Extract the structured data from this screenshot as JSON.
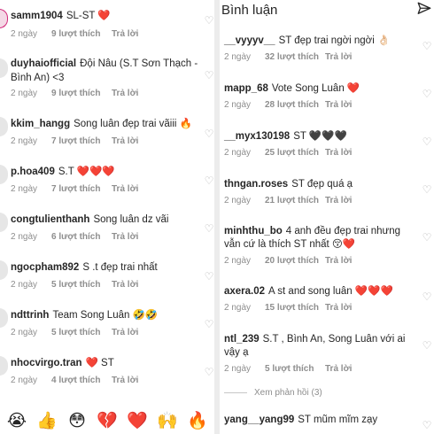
{
  "left_panel": {
    "comments": [
      {
        "user": "samm1904",
        "text": "SL-ST ❤️",
        "time": "2 ngày",
        "likes": "9 lượt thích",
        "reply": "Trả lời"
      },
      {
        "user": "duyhaiofficial",
        "text": "Đội Nâu (S.T Sơn Thạch -",
        "text2": "Bình An) <3",
        "time": "2 ngày",
        "likes": "9 lượt thích",
        "reply": "Trả lời"
      },
      {
        "user": "kkim_hangg",
        "text": "Song luân đẹp trai vãiii 🔥",
        "time": "2 ngày",
        "likes": "7 lượt thích",
        "reply": "Trả lời"
      },
      {
        "user": "p.hoa409",
        "text": "S.T ❤️❤️❤️",
        "time": "2 ngày",
        "likes": "7 lượt thích",
        "reply": "Trả lời"
      },
      {
        "user": "congtulienthanh",
        "text": "Song luân dz vãi",
        "time": "2 ngày",
        "likes": "6 lượt thích",
        "reply": "Trả lời"
      },
      {
        "user": "ngocpham892",
        "text": "S .t đẹp trai nhất",
        "time": "2 ngày",
        "likes": "5 lượt thích",
        "reply": "Trả lời"
      },
      {
        "user": "ndttrinh",
        "text": "Team Song Luân 🤣🤣",
        "time": "2 ngày",
        "likes": "5 lượt thích",
        "reply": "Trả lời"
      },
      {
        "user": "nhocvirgo.tran",
        "text": "❤️ ST",
        "time": "2 ngày",
        "likes": "4 lượt thích",
        "reply": "Trả lời"
      }
    ],
    "emoji_bar": [
      "😭",
      "👍",
      "😳",
      "💔",
      "❤️",
      "🙌",
      "🔥"
    ]
  },
  "right_panel": {
    "title": "Bình luận",
    "send_icon": "send-icon",
    "comments": [
      {
        "user": "__vyyyv__",
        "text": "ST đẹp trai ngời ngời 👌🏻",
        "time": "2 ngày",
        "likes": "32 lượt thích",
        "reply": "Trả lời"
      },
      {
        "user": "mapp_68",
        "text": "Vote Song Luân ❤️",
        "time": "2 ngày",
        "likes": "28 lượt thích",
        "reply": "Trả lời"
      },
      {
        "user": "__myx130198",
        "text": "ST 🖤🖤🖤",
        "time": "2 ngày",
        "likes": "25 lượt thích",
        "reply": "Trả lời"
      },
      {
        "user": "thngan.roses",
        "text": "ST đẹp quá ạ",
        "time": "2 ngày",
        "likes": "21 lượt thích",
        "reply": "Trả lời"
      },
      {
        "user": "minhthu_bo",
        "text": "4 anh đều đẹp trai nhưng",
        "text2": "vẫn cứ là thích ST nhất 😚❤️",
        "time": "2 ngày",
        "likes": "20 lượt thích",
        "reply": "Trả lời"
      },
      {
        "user": "axera.02",
        "text": "A st and song luân ❤️❤️❤️",
        "time": "2 ngày",
        "likes": "15 lượt thích",
        "reply": "Trả lời"
      },
      {
        "user": "ntl_239",
        "text": "S.T , Bình An, Song Luân với ai",
        "text2": "vậy ạ",
        "time": "2 ngày",
        "likes": "5 lượt thích",
        "reply": "Trả lời"
      },
      {
        "user": "yang__yang99",
        "text": "ST mũm mĩm zạy"
      }
    ],
    "view_replies": "Xem phản hồi (3)"
  },
  "colors": {
    "accent_ring": "#d22a7b",
    "heart_red": "#ed2e2e",
    "meta_gray": "#8e8e8e"
  }
}
